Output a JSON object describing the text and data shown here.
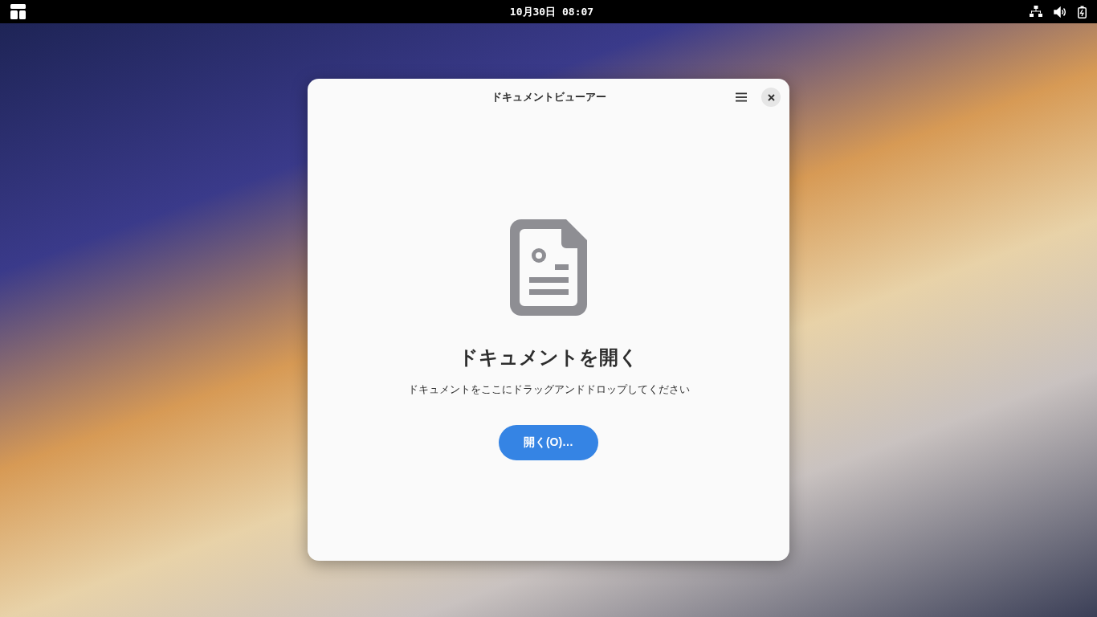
{
  "top_bar": {
    "clock": "10月30日 08:07"
  },
  "window": {
    "title": "ドキュメントビューアー"
  },
  "empty_state": {
    "heading": "ドキュメントを開く",
    "description": "ドキュメントをここにドラッグアンドドロップしてください",
    "button": "開く(O)…"
  }
}
